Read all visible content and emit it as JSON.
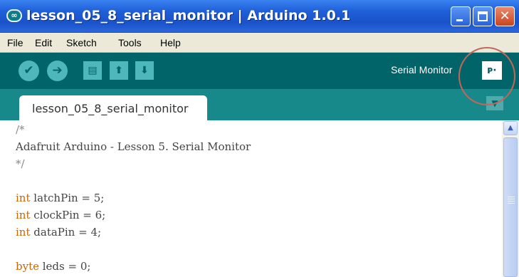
{
  "window": {
    "title": "lesson_05_8_serial_monitor | Arduino 1.0.1",
    "app_icon": "∞",
    "controls": [
      "minimize",
      "maximize",
      "close"
    ]
  },
  "menu": [
    "File",
    "Edit",
    "Sketch",
    "Tools",
    "Help"
  ],
  "toolbar": {
    "buttons": [
      {
        "name": "verify",
        "icon": "checkmark-icon",
        "glyph": "✔"
      },
      {
        "name": "upload",
        "icon": "arrow-right-icon",
        "glyph": "➔"
      },
      {
        "name": "new",
        "icon": "new-file-icon",
        "glyph": "▤"
      },
      {
        "name": "open",
        "icon": "open-arrow-up-icon",
        "glyph": "⬆"
      },
      {
        "name": "save",
        "icon": "save-arrow-down-icon",
        "glyph": "⬇"
      }
    ],
    "serial_monitor_label": "Serial Monitor",
    "serial_monitor_glyph": "ᴘ·"
  },
  "tabs": {
    "active": "lesson_05_8_serial_monitor",
    "menu_glyph": "▼"
  },
  "editor": {
    "lines": [
      {
        "text": "/*"
      },
      {
        "text": "Adafruit Arduino - Lesson 5. Serial Monitor"
      },
      {
        "text": "*/"
      },
      {
        "text": ""
      },
      {
        "kw": "int",
        "text": " latchPin = 5;"
      },
      {
        "kw": "int",
        "text": " clockPin = 6;"
      },
      {
        "kw": "int",
        "text": " dataPin = 4;"
      },
      {
        "text": ""
      },
      {
        "kw": "byte",
        "text": " leds = 0;"
      }
    ]
  },
  "colors": {
    "toolbar_bg": "#006468",
    "tabbar_bg": "#17898b",
    "keyword": "#cc6600",
    "highlight_ring": "#c2665a"
  }
}
